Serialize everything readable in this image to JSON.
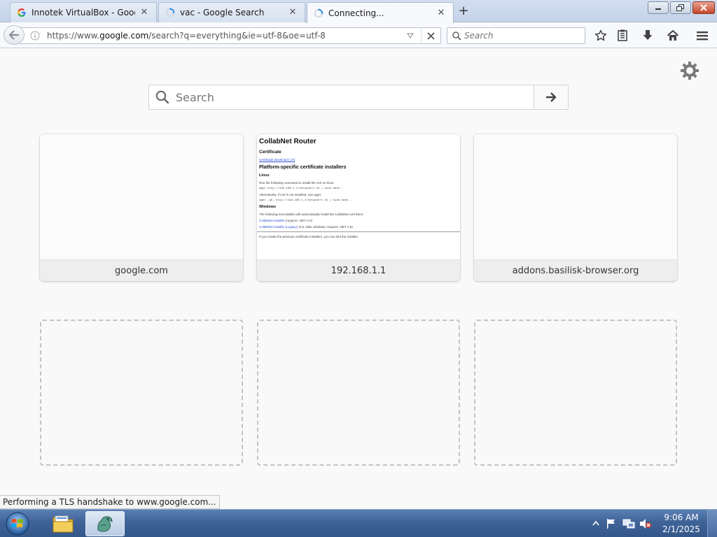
{
  "browser": {
    "tabs": [
      {
        "label": "Innotek VirtualBox - Google",
        "favicon": "google-g-icon",
        "state": "inactive"
      },
      {
        "label": "vac - Google Search",
        "favicon": "loading-spinner-icon",
        "state": "inactive"
      },
      {
        "label": "Connecting...",
        "favicon": "loading-spinner-icon",
        "state": "active"
      }
    ],
    "new_tab": "+",
    "url": {
      "prefix": "https://www.",
      "host": "google.com",
      "path": "/search?q=everything&ie=utf-8&oe=utf-8"
    },
    "search_placeholder": "Search"
  },
  "newtab_page": {
    "search_placeholder": "Search",
    "tiles": [
      {
        "title": "google.com"
      },
      {
        "title": "192.168.1.1"
      },
      {
        "title": "addons.basilisk-browser.org"
      }
    ],
    "preview": {
      "h1": "CollabNet Router",
      "h2a": "Certificate",
      "link1": "Certificate download (.crt)",
      "h2b": "Platform-specific certificate installers",
      "h3": "Linux",
      "t1": "Run the following command to install the cert on linux:",
      "m1": "wget http://192.168.1.1/setupcert.sh | sudo bash -",
      "t2": "Alternatively, if curl is not installed, use wget:",
      "m2": "wget -qO- http://192.168.1.1/setupcert.sh | sudo bash -",
      "h3b": "Windows",
      "t3": "The following executables will automatically install the CollabNet cert there:",
      "link2": "CollabNet installer",
      "l2suffix": " (requires .NET 4.0)",
      "link3": "CollabNet installer (Legacy)",
      "l3suffix": " (For older windows; requires .NET 3.5)",
      "t4": "If you create the previous certificate installers, you can find the installer"
    }
  },
  "status_text": "Performing a TLS handshake to www.google.com...",
  "taskbar": {
    "clock_time": "9:06 AM",
    "clock_date": "2/1/2025"
  },
  "colors": {
    "link_blue": "#2a4ed8",
    "taskbar_blue": "#3f6397",
    "close_red": "#c6452b",
    "spinner_blue": "#2a8fe0"
  }
}
